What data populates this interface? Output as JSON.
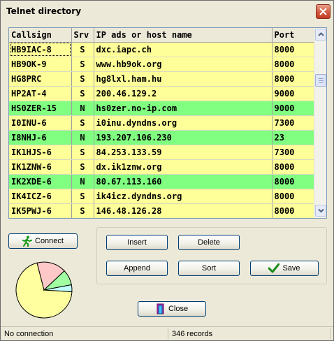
{
  "window": {
    "title": "Telnet directory"
  },
  "grid": {
    "columns": [
      "Callsign",
      "Srv",
      "IP ads or host name",
      "Port"
    ],
    "rows": [
      {
        "callsign": "HB9IAC-8",
        "srv": "S",
        "host": "dxc.iapc.ch",
        "port": "8000",
        "highlight": "yellow",
        "selected": true
      },
      {
        "callsign": "HB9OK-9",
        "srv": "S",
        "host": "www.hb9ok.org",
        "port": "8000",
        "highlight": "yellow"
      },
      {
        "callsign": "HG8PRC",
        "srv": "S",
        "host": "hg8lxl.ham.hu",
        "port": "8000",
        "highlight": "yellow"
      },
      {
        "callsign": "HP2AT-4",
        "srv": "S",
        "host": "200.46.129.2",
        "port": "9000",
        "highlight": "yellow"
      },
      {
        "callsign": "HS0ZER-15",
        "srv": "N",
        "host": "hs0zer.no-ip.com",
        "port": "9000",
        "highlight": "green"
      },
      {
        "callsign": "I0INU-6",
        "srv": "S",
        "host": "i0inu.dyndns.org",
        "port": "7300",
        "highlight": "yellow"
      },
      {
        "callsign": "I8NHJ-6",
        "srv": "N",
        "host": "193.207.106.230",
        "port": "23",
        "highlight": "green"
      },
      {
        "callsign": "IK1HJS-6",
        "srv": "S",
        "host": "84.253.133.59",
        "port": "7300",
        "highlight": "yellow"
      },
      {
        "callsign": "IK1ZNW-6",
        "srv": "S",
        "host": "dx.ik1znw.org",
        "port": "8000",
        "highlight": "yellow"
      },
      {
        "callsign": "IK2XDE-6",
        "srv": "N",
        "host": "80.67.113.160",
        "port": "8000",
        "highlight": "green"
      },
      {
        "callsign": "IK4ICZ-6",
        "srv": "S",
        "host": "ik4icz.dyndns.org",
        "port": "8000",
        "highlight": "yellow"
      },
      {
        "callsign": "IK5PWJ-6",
        "srv": "S",
        "host": "146.48.126.28",
        "port": "8000",
        "highlight": "yellow"
      }
    ]
  },
  "buttons": {
    "connect": "Connect",
    "insert": "Insert",
    "delete": "Delete",
    "append": "Append",
    "sort": "Sort",
    "save": "Save",
    "close": "Close"
  },
  "status": {
    "connection": "No connection",
    "records": "346 records"
  },
  "colors": {
    "row_yellow": "#ffff99",
    "row_green": "#80ff80",
    "pie_main": "#ffffa0",
    "pie_pink": "#ffc8c8",
    "pie_green": "#a0ffa0",
    "pie_cyan": "#c0ffff"
  },
  "icons": {
    "connect": "running-man-icon",
    "save": "checkmark-icon",
    "close": "door-exit-icon",
    "window_close": "close-icon"
  }
}
